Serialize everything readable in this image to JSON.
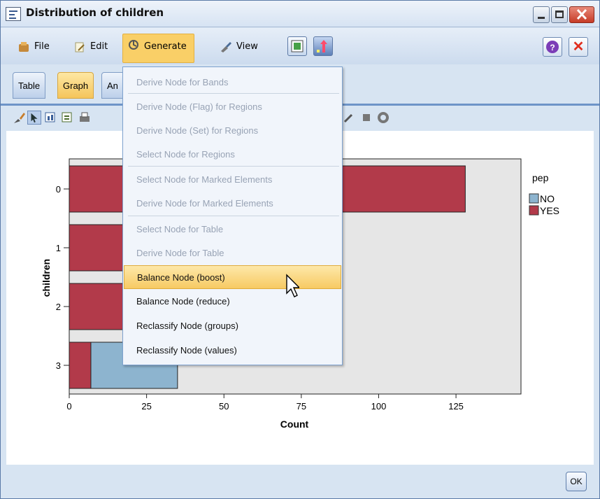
{
  "window": {
    "title": "Distribution of children"
  },
  "menubar": {
    "items": [
      {
        "label": "File",
        "icon": "file-icon"
      },
      {
        "label": "Edit",
        "icon": "edit-icon"
      },
      {
        "label": "Generate",
        "icon": "generate-icon"
      },
      {
        "label": "View",
        "icon": "view-icon"
      }
    ],
    "help_label": "?",
    "close_label": "✕"
  },
  "tabs": [
    {
      "label": "Table"
    },
    {
      "label": "Graph"
    },
    {
      "label": "An"
    }
  ],
  "generate_menu": {
    "items": [
      {
        "label": "Derive Node for Bands",
        "enabled": false
      },
      {
        "label": "Derive Node (Flag) for Regions",
        "enabled": false
      },
      {
        "label": "Derive Node (Set) for Regions",
        "enabled": false
      },
      {
        "label": "Select Node for Regions",
        "enabled": false
      },
      {
        "label": "Select Node for Marked Elements",
        "enabled": false
      },
      {
        "label": "Derive Node for Marked Elements",
        "enabled": false
      },
      {
        "label": "Select Node for Table",
        "enabled": false
      },
      {
        "label": "Derive Node for Table",
        "enabled": false
      },
      {
        "label": "Balance Node (boost)",
        "enabled": true,
        "highlighted": true
      },
      {
        "label": "Balance Node (reduce)",
        "enabled": true
      },
      {
        "label": "Reclassify Node (groups)",
        "enabled": true
      },
      {
        "label": "Reclassify Node (values)",
        "enabled": true
      }
    ]
  },
  "chart_data": {
    "type": "bar",
    "orientation": "horizontal",
    "stacked": true,
    "categories": [
      "0",
      "1",
      "2",
      "3"
    ],
    "series": [
      {
        "name": "YES",
        "color": "#b23a4a",
        "values": [
          128,
          75,
          69,
          7
        ]
      },
      {
        "name": "NO",
        "color": "#8db4cf",
        "values": [
          0,
          0,
          0,
          28
        ]
      }
    ],
    "xlabel": "Count",
    "ylabel": "children",
    "xlim": [
      0,
      146
    ],
    "x_ticks": [
      "0",
      "25",
      "50",
      "75",
      "100",
      "125"
    ],
    "legend_title": "pep",
    "legend_entries": [
      "NO",
      "YES"
    ],
    "legend_placement": "right"
  },
  "footer": {
    "ok_label": "OK"
  }
}
